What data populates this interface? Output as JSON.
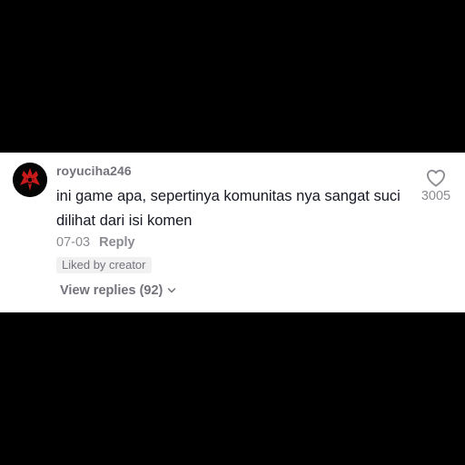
{
  "comment": {
    "username": "royuciha246",
    "text": "ini game apa, sepertinya komunitas nya sangat suci dilihat dari isi komen",
    "date": "07-03",
    "reply_label": "Reply",
    "badge": "Liked by creator",
    "view_replies_label": "View replies (92)",
    "like_count": "3005",
    "avatar_icon": "sharingan-icon",
    "heart_icon": "heart-outline-icon",
    "chevron_icon": "chevron-down-icon"
  }
}
